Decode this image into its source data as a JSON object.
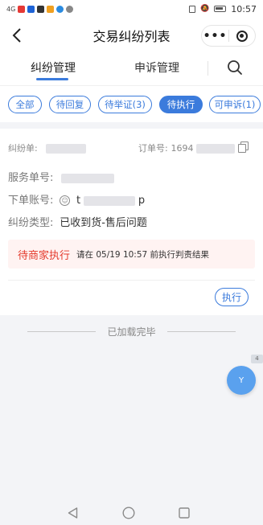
{
  "status_bar": {
    "network": "4G",
    "time": "10:57",
    "app_icon_colors": [
      "#e53935",
      "#1e63d6",
      "#333333",
      "#f0a020",
      "#2a8be0",
      "#888888"
    ]
  },
  "header": {
    "back_icon": "chevron-left-icon",
    "title": "交易纠纷列表",
    "more_label": "•••"
  },
  "tabs": {
    "items": [
      {
        "label": "纠纷管理",
        "active": true
      },
      {
        "label": "申诉管理",
        "active": false
      }
    ],
    "search_icon": "search-icon"
  },
  "filters": {
    "chips": [
      {
        "label": "全部",
        "active": false
      },
      {
        "label": "待回复",
        "active": false
      },
      {
        "label": "待举证(3)",
        "active": false
      },
      {
        "label": "待执行",
        "active": true
      },
      {
        "label": "可申诉(1)",
        "active": false
      }
    ]
  },
  "dispute_card": {
    "dispute_no_label": "纠纷单:",
    "order_no_label": "订单号:",
    "order_no_visible": "1694",
    "service_no_label": "服务单号:",
    "account_label": "下单账号:",
    "account_visible_start": "t",
    "account_visible_end": "p",
    "type_label": "纠纷类型:",
    "type_value": "已收到货-售后问题",
    "status": "待商家执行",
    "status_message": "请在 05/19 10:57 前执行判责结果",
    "action_label": "执行"
  },
  "list_footer": "已加载完毕",
  "fab_label": "Y",
  "side_tag": "4"
}
